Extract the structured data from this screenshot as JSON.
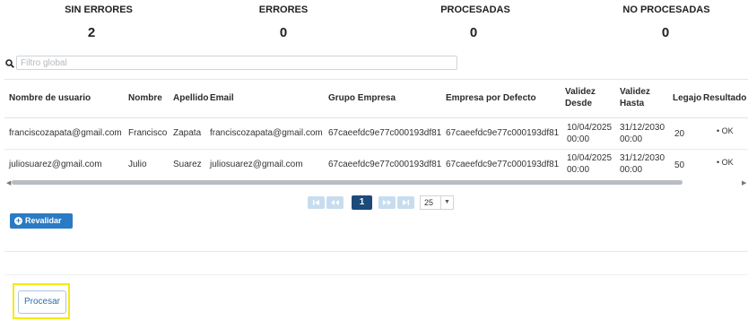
{
  "stats": [
    {
      "label": "SIN ERRORES",
      "value": "2"
    },
    {
      "label": "ERRORES",
      "value": "0"
    },
    {
      "label": "PROCESADAS",
      "value": "0"
    },
    {
      "label": "NO PROCESADAS",
      "value": "0"
    }
  ],
  "search": {
    "placeholder": "Filtro global",
    "value": ""
  },
  "table": {
    "columns": {
      "usuario": "Nombre de usuario",
      "nombre": "Nombre",
      "apellido": "Apellido",
      "email": "Email",
      "grupo": "Grupo Empresa",
      "empresa": "Empresa por Defecto",
      "desde_1": "Validez",
      "desde_2": "Desde",
      "hasta_1": "Validez",
      "hasta_2": "Hasta",
      "legajo": "Legajo",
      "resultado": "Resultado"
    },
    "rows": [
      {
        "usuario": "franciscozapata@gmail.com",
        "nombre": "Francisco",
        "apellido": "Zapata",
        "email": "franciscozapata@gmail.com",
        "grupo": "67caeefdc9e77c000193df81",
        "empresa": "67caeefdc9e77c000193df81",
        "desde_date": "10/04/2025",
        "desde_time": "00:00",
        "hasta_date": "31/12/2030",
        "hasta_time": "00:00",
        "legajo": "20",
        "resultado": "OK"
      },
      {
        "usuario": "juliosuarez@gmail.com",
        "nombre": "Julio",
        "apellido": "Suarez",
        "email": "juliosuarez@gmail.com",
        "grupo": "67caeefdc9e77c000193df81",
        "empresa": "67caeefdc9e77c000193df81",
        "desde_date": "10/04/2025",
        "desde_time": "00:00",
        "hasta_date": "31/12/2030",
        "hasta_time": "00:00",
        "legajo": "50",
        "resultado": "OK"
      }
    ]
  },
  "pager": {
    "current_page": "1",
    "page_size": "25"
  },
  "buttons": {
    "revalidar": "Revalidar",
    "procesar": "Procesar"
  },
  "colors": {
    "primary": "#2b7bc4",
    "active_page": "#1d4a79",
    "highlight": "#f3ea14"
  },
  "icons": [
    "search-icon",
    "first-page-icon",
    "prev-page-icon",
    "next-page-icon",
    "last-page-icon",
    "plus-circle-icon",
    "chevron-down-icon"
  ]
}
